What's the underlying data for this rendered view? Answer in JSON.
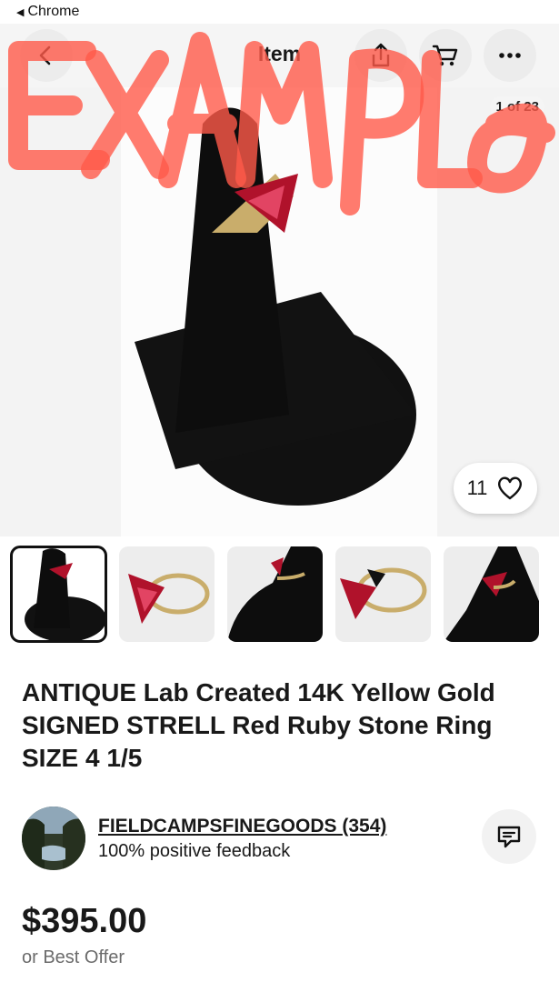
{
  "statusbar": {
    "back_label": "Chrome"
  },
  "header": {
    "title": "Item"
  },
  "gallery": {
    "counter": "1 of 23",
    "watch_count": "11"
  },
  "overlay": {
    "watermark": "EXAMPLE"
  },
  "item": {
    "title_line1": "ANTIQUE Lab Created 14K Yellow Gold",
    "title_line2": "SIGNED STRELL Red Ruby Stone Ring",
    "title_line3": "SIZE 4 1/5"
  },
  "seller": {
    "name": "FIELDCAMPSFINEGOODS",
    "count": "(354)",
    "feedback": "100% positive feedback"
  },
  "pricing": {
    "price": "$395.00",
    "offer": "or Best Offer"
  },
  "icons": {
    "back": "chevron-left-icon",
    "share": "share-icon",
    "cart": "cart-icon",
    "more": "more-icon",
    "heart": "heart-icon",
    "message": "message-icon"
  }
}
